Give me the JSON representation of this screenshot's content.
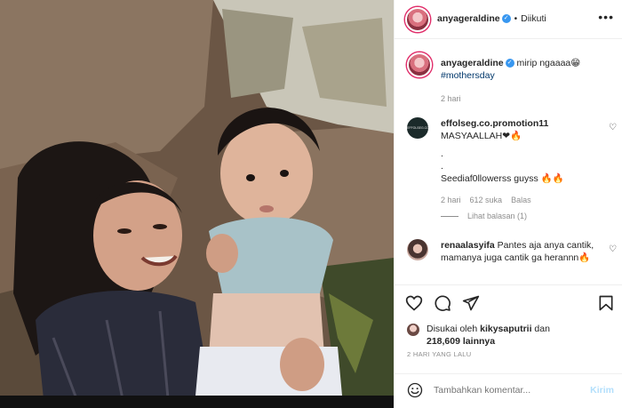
{
  "post": {
    "author": "anyageraldine",
    "follow_state": "Diikuti",
    "separator": "•",
    "caption_text": "mirip ngaaaa😁",
    "hashtag": "#mothersday",
    "caption_time": "2 hari",
    "verified_mark": "✓",
    "more_icon": "more-horizontal-icon"
  },
  "comments": [
    {
      "username": "effolseg.co.promotion11",
      "avatar_text": "EFFOLSEG.CO",
      "line1": "MASYAALLAH❤🔥",
      "line2": ".",
      "line3": ".",
      "line4": "Seediaf0llowerss guyss 🔥🔥",
      "time": "2 hari",
      "likes": "612 suka",
      "reply": "Balas",
      "view_replies": "Lihat balasan (1)"
    },
    {
      "username": "renaalasyifa",
      "text": "Pantes aja anya cantik, mamanya juga cantik ga herannn🔥"
    }
  ],
  "likes": {
    "prefix": "Disukai oleh",
    "user": "kikysaputrii",
    "middle": "dan",
    "count": "218,609",
    "suffix": "lainnya"
  },
  "date": "2 HARI YANG LALU",
  "comment_box": {
    "placeholder": "Tambahkan komentar...",
    "post_label": "Kirim"
  },
  "colors": {
    "link_blue": "#00376b",
    "verified_blue": "#3897f0",
    "post_disabled": "#b2dffc",
    "muted": "#8e8e8e"
  },
  "icons": [
    "heart-icon",
    "comment-icon",
    "share-icon",
    "bookmark-icon",
    "emoji-icon",
    "more-horizontal-icon"
  ]
}
